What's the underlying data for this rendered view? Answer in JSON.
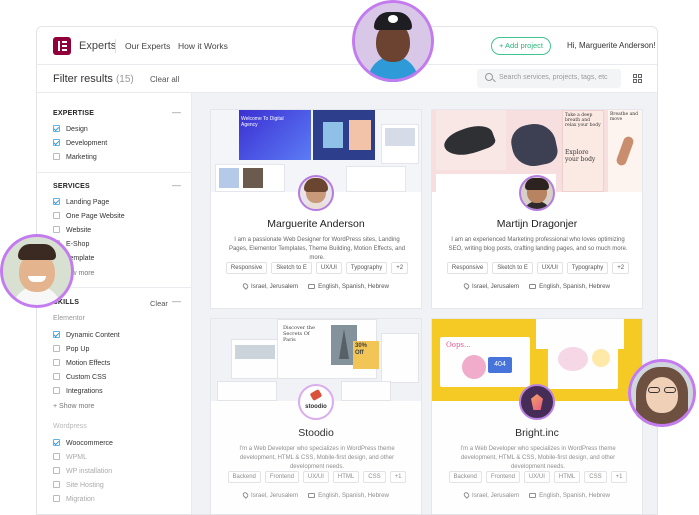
{
  "app": {
    "brand": "Experts",
    "nav": [
      "Our Experts",
      "How it Works"
    ],
    "add_project": "+ Add project",
    "greeting": "Hi, Marguerite Anderson!",
    "caret": "⌄"
  },
  "filter": {
    "title": "Filter results",
    "count": "(15)",
    "clear_all": "Clear all",
    "search_placeholder": "Search services, projects, tags, etc"
  },
  "sidebar": {
    "expertise": {
      "title": "EXPERTISE",
      "items": [
        {
          "label": "Design",
          "checked": true
        },
        {
          "label": "Development",
          "checked": true
        },
        {
          "label": "Marketing",
          "checked": false
        }
      ]
    },
    "services": {
      "title": "SERVICES",
      "items": [
        {
          "label": "Landing Page",
          "checked": true
        },
        {
          "label": "One Page Website",
          "checked": false
        },
        {
          "label": "Website",
          "checked": false
        },
        {
          "label": "E-Shop",
          "checked": false
        },
        {
          "label": "Template",
          "checked": false
        }
      ],
      "show_more": "+ Show more"
    },
    "skills": {
      "title": "SKILLS",
      "clear": "Clear",
      "elementor_label": "Elementor",
      "elementor_items": [
        {
          "label": "Dynamic Content",
          "checked": true
        },
        {
          "label": "Pop Up",
          "checked": false
        },
        {
          "label": "Motion Effects",
          "checked": false
        },
        {
          "label": "Custom CSS",
          "checked": false
        },
        {
          "label": "Integrations",
          "checked": false
        }
      ],
      "show_more": "+ Show more",
      "wordpress_label": "Wordpress",
      "wordpress_items": [
        {
          "label": "Woocommerce",
          "checked": true
        },
        {
          "label": "WPML",
          "checked": false
        },
        {
          "label": "WP installation",
          "checked": false
        },
        {
          "label": "Site Hosting",
          "checked": false
        },
        {
          "label": "Migration",
          "checked": false
        }
      ]
    },
    "minus": "—"
  },
  "cards": [
    {
      "name": "Marguerite Anderson",
      "desc": "I am a passionate Web Designer for WordPress sites, Landing Pages, Elementor Templates, Theme Building, Motion Effects, and more.",
      "tags": [
        "Responsive",
        "Sketch to E",
        "UX/UI",
        "Typography",
        "+2"
      ],
      "location": "Israel, Jerusalem",
      "languages": "English, Spanish, Hebrew"
    },
    {
      "name": "Martijn Dragonjer",
      "desc": "I am an experienced Marketing professional who loves optimizing SEO, writing blog posts, crafting landing pages, and so much more.",
      "tags": [
        "Responsive",
        "Sketch to E",
        "UX/UI",
        "Typography",
        "+2"
      ],
      "location": "Israel, Jerusalem",
      "languages": "English, Spanish, Hebrew"
    },
    {
      "name": "Stoodio",
      "logo_text": "stoodio",
      "desc": "I'm a Web Developer who specializes in WordPress theme development, HTML & CSS, Mobile-first design, and other development needs.",
      "tags": [
        "Backend",
        "Frontend",
        "UX/UI",
        "HTML",
        "CSS",
        "+1"
      ],
      "location": "Israel, Jerusalem",
      "languages": "English, Spanish, Hebrew"
    },
    {
      "name": "Bright.inc",
      "desc": "I'm a Web Developer who specializes in WordPress theme development, HTML & CSS, Mobile-first design, and other development needs.",
      "tags": [
        "Backend",
        "Frontend",
        "UX/UI",
        "HTML",
        "CSS",
        "+1"
      ],
      "location": "Israel, Jerusalem",
      "languages": "English, Spanish, Hebrew"
    }
  ],
  "mockups": {
    "c1_headline": "Welcome To Digital Agency",
    "c2_text1": "Take a deep breath and relax your body",
    "c2_text2": "Explore your body",
    "c2_text3": "Breathe and move",
    "c3_text1": "Discover the Secrets Of Paris",
    "c3_text2": "30% Off",
    "c4_text1": "Oops...",
    "c4_text2": "404"
  },
  "colors": {
    "accent": "#92003b",
    "green": "#2bb57c",
    "ring": "#c47bf0",
    "yellow": "#f6c816"
  }
}
